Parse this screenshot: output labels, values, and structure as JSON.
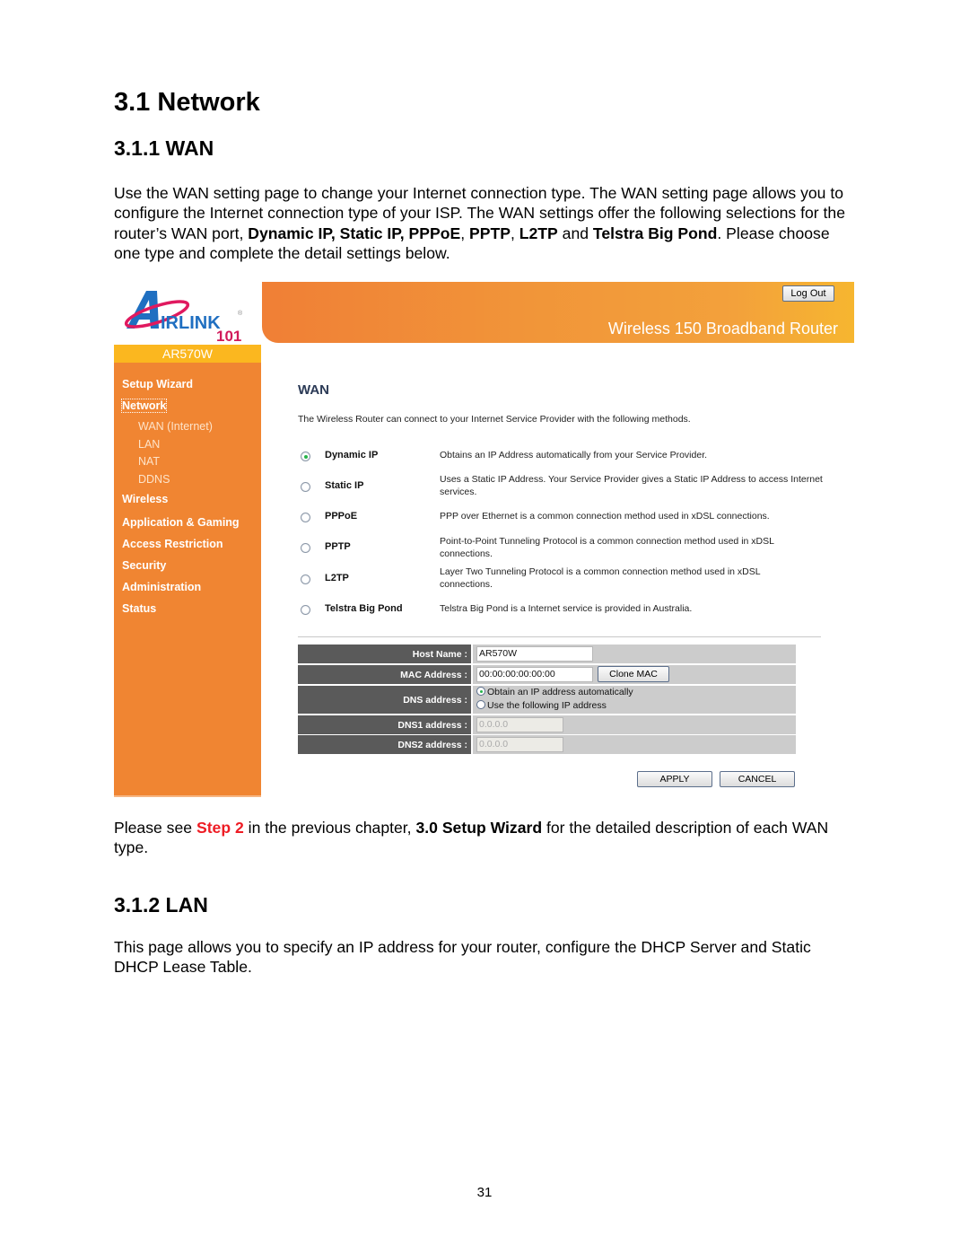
{
  "document": {
    "heading_main": "3.1 Network",
    "heading_wan": "3.1.1 WAN",
    "wan_intro": {
      "t1": "Use the WAN setting page to change your Internet connection type. The WAN setting page allows you to configure the Internet connection type of your ISP. The WAN settings offer the following selections for the router’s WAN port, ",
      "b1": "Dynamic IP, Static IP, PPPoE",
      "t2": ", ",
      "b2": "PPTP",
      "t3": ", ",
      "b3": "L2TP",
      "t4": " and ",
      "b4": "Telstra Big Pond",
      "t5": ". Please choose one type and complete the detail settings below."
    },
    "after_screenshot": {
      "t1": "Please see ",
      "step": "Step 2",
      "t2": " in the previous chapter, ",
      "b1": "3.0 Setup Wizard",
      "t3": " for the detailed description of each WAN type."
    },
    "heading_lan": "3.1.2 LAN",
    "lan_intro": "This page allows you to specify an IP address for your router, configure the DHCP Server and Static DHCP Lease Table.",
    "page_number": "31",
    "colors": {
      "step_red": "#ee1c24"
    }
  },
  "router_ui": {
    "brand": {
      "logo_text": "AIRLINK",
      "logo_sub": "101",
      "registered": "®",
      "model": "AR570W"
    },
    "header": {
      "logout_label": "Log Out",
      "product_title": "Wireless 150 Broadband Router"
    },
    "colors": {
      "sidebar": "#f08532",
      "model_bar": "#fbb71f",
      "label_bg": "#5a5a5a",
      "value_bg": "#cccccc"
    },
    "sidebar": {
      "items": [
        {
          "label": "Setup Wizard"
        },
        {
          "label": "Network",
          "active": true
        },
        {
          "label": "WAN (Internet)",
          "sub": true
        },
        {
          "label": "LAN",
          "sub": true
        },
        {
          "label": "NAT",
          "sub": true
        },
        {
          "label": "DDNS",
          "sub": true
        },
        {
          "label": "Wireless"
        },
        {
          "label": "Application & Gaming"
        },
        {
          "label": "Access Restriction"
        },
        {
          "label": "Security"
        },
        {
          "label": "Administration"
        },
        {
          "label": "Status"
        }
      ]
    },
    "wan": {
      "title": "WAN",
      "intro": "The Wireless Router can connect to your Internet Service Provider with the following methods.",
      "options": [
        {
          "label": "Dynamic IP",
          "desc": "Obtains an IP Address automatically from your Service Provider.",
          "selected": true
        },
        {
          "label": "Static IP",
          "desc": "Uses a Static IP Address. Your Service Provider gives a Static IP Address to access Internet services.",
          "selected": false
        },
        {
          "label": "PPPoE",
          "desc": "PPP over Ethernet is a common connection method used in xDSL connections.",
          "selected": false
        },
        {
          "label": "PPTP",
          "desc": "Point-to-Point Tunneling Protocol is a common connection method used in xDSL connections.",
          "selected": false
        },
        {
          "label": "L2TP",
          "desc": "Layer Two Tunneling Protocol is a common connection method used in xDSL connections.",
          "selected": false
        },
        {
          "label": "Telstra Big Pond",
          "desc": "Telstra Big Pond is a Internet service is provided in Australia.",
          "selected": false
        }
      ]
    },
    "form": {
      "host_name_label": "Host Name :",
      "host_name_value": "AR570W",
      "mac_label": "MAC Address :",
      "mac_value": "00:00:00:00:00:00",
      "clone_mac_label": "Clone MAC",
      "dns_label": "DNS address :",
      "dns_auto_label": "Obtain an IP address automatically",
      "dns_manual_label": "Use the following IP address",
      "dns_mode": "auto",
      "dns1_label": "DNS1 address :",
      "dns1_value": "0.0.0.0",
      "dns2_label": "DNS2 address :",
      "dns2_value": "0.0.0.0",
      "apply_label": "APPLY",
      "cancel_label": "CANCEL"
    }
  }
}
